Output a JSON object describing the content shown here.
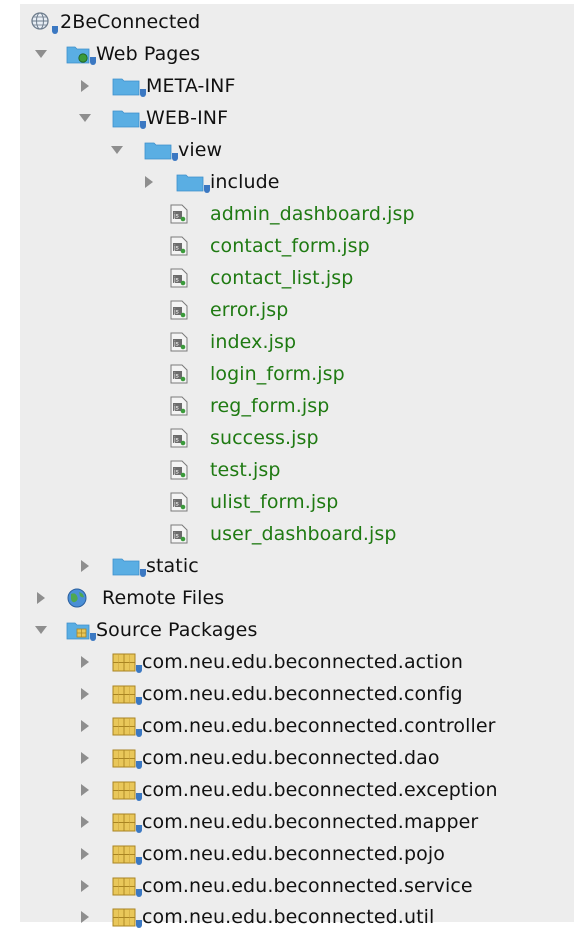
{
  "colors": {
    "panel_bg": "#ededed",
    "folder": "#5aaee3",
    "folder_dark": "#3e8fcb",
    "file_label": "#1f7a12",
    "text": "#111111",
    "toggle": "#8e8e8e",
    "package": "#e9c75a"
  },
  "tree": {
    "project": {
      "label": "2BeConnected",
      "icon": "globe-icon"
    },
    "web_pages": {
      "label": "Web Pages",
      "meta_inf": "META-INF",
      "web_inf": "WEB-INF",
      "view": "view",
      "include": "include",
      "files": [
        "admin_dashboard.jsp",
        "contact_form.jsp",
        "contact_list.jsp",
        "error.jsp",
        "index.jsp",
        "login_form.jsp",
        "reg_form.jsp",
        "success.jsp",
        "test.jsp",
        "ulist_form.jsp",
        "user_dashboard.jsp"
      ],
      "static": "static"
    },
    "remote_files": {
      "label": "Remote Files"
    },
    "source_packages": {
      "label": "Source Packages",
      "packages": [
        "com.neu.edu.beconnected.action",
        "com.neu.edu.beconnected.config",
        "com.neu.edu.beconnected.controller",
        "com.neu.edu.beconnected.dao",
        "com.neu.edu.beconnected.exception",
        "com.neu.edu.beconnected.mapper",
        "com.neu.edu.beconnected.pojo",
        "com.neu.edu.beconnected.service",
        "com.neu.edu.beconnected.util"
      ]
    }
  }
}
